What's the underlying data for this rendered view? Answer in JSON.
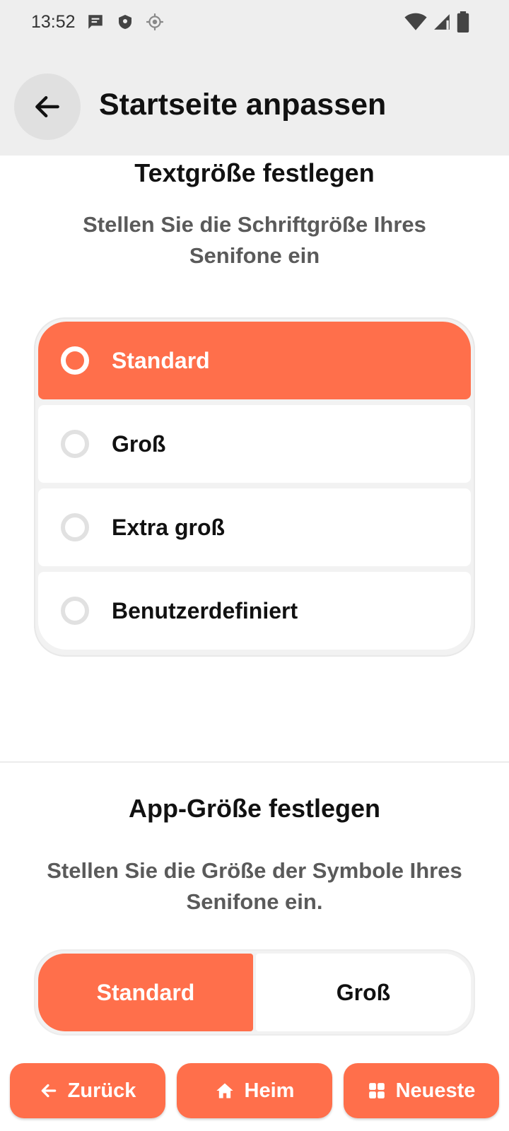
{
  "status_bar": {
    "time": "13:52",
    "left_icons": [
      "message-icon",
      "shield-icon",
      "location-icon"
    ],
    "right_icons": [
      "wifi-icon",
      "signal-icon",
      "battery-icon"
    ]
  },
  "app_bar": {
    "back_icon": "arrow-left-icon",
    "title": "Startseite anpassen"
  },
  "text_size": {
    "title": "Textgröße festlegen",
    "subtitle": "Stellen Sie die Schriftgröße Ihres Senifone ein",
    "options": [
      {
        "label": "Standard",
        "selected": true
      },
      {
        "label": "Groß",
        "selected": false
      },
      {
        "label": "Extra groß",
        "selected": false
      },
      {
        "label": "Benutzerdefiniert",
        "selected": false
      }
    ]
  },
  "app_size": {
    "title": "App-Größe festlegen",
    "subtitle": "Stellen Sie die Größe der Symbole Ihres Senifone ein.",
    "options": [
      {
        "label": "Standard",
        "selected": true
      },
      {
        "label": "Groß",
        "selected": false
      }
    ]
  },
  "bottom_nav": {
    "back_label": "Zurück",
    "home_label": "Heim",
    "recent_label": "Neueste"
  },
  "colors": {
    "accent": "#ff6f4b",
    "header_bg": "#eeeeee",
    "subtitle_text": "#5a5a5a"
  }
}
